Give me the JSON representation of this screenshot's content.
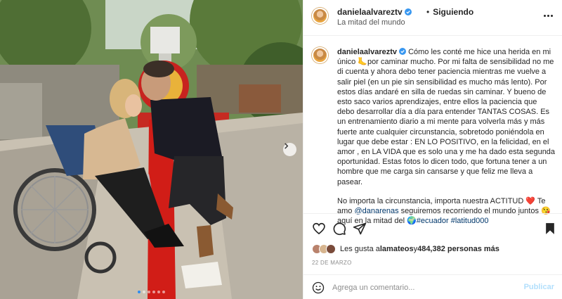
{
  "post": {
    "username": "danielaalvareztv",
    "follow_status": "Siguiendo",
    "location": "La mitad del mundo"
  },
  "caption": {
    "username": "danielaalvareztv",
    "text1": "Cómo les conté me hice una herida en mi único 🦶por caminar mucho. Por mi falta de sensibilidad no me di cuenta y ahora debo tener paciencia mientras me vuelve a salir piel (en un pie sin sensibilidad es mucho más lento). Por estos días andaré en silla de ruedas sin caminar. Y bueno de esto saco varios aprendizajes, entre ellos la paciencia que debo desarrollar día a día para entender TANTAS COSAS. Es un entrenamiento diario a mi mente para volverla más y más fuerte ante cualquier circunstancia, sobretodo poniéndola en lugar que debe estar : EN LO POSITIVO, en la felicidad, en el amor , en LA VIDA que es solo una y me ha dado esta segunda oportunidad. Estas fotos lo dicen todo, que fortuna tener a un hombre que me carga sin cansarse y que feliz me lleva a pasear.",
    "text2_a": "No importa la circunstancia, importa nuestra ACTITUD ❤️ Te amo ",
    "mention": "@danarenas",
    "text2_b": " seguiremos recorriendo el mundo juntos 😘 aquí en la mitad del 🌍",
    "hashtag1": "#ecuador",
    "hashtag2": "#latitud000"
  },
  "likes": {
    "prefix": "Les gusta a ",
    "user": "lamateos",
    "middle": " y ",
    "count": "484,382 personas más"
  },
  "date": "22 DE MARZO",
  "comment": {
    "placeholder": "Agrega un comentario...",
    "post_label": "Publicar"
  },
  "icons": {
    "like": "heart-icon",
    "comment": "comment-icon",
    "share": "paper-plane-icon",
    "save": "bookmark-icon",
    "emoji": "smiley-icon",
    "more": "more-dots-icon",
    "next": "chevron-right-icon"
  },
  "carousel": {
    "slides": 6,
    "active_index": 0
  },
  "colors": {
    "link": "#00376b",
    "verified": "#3897f0",
    "post_button_disabled": "#b2dffc",
    "active_dot": "#2d8cf0"
  }
}
